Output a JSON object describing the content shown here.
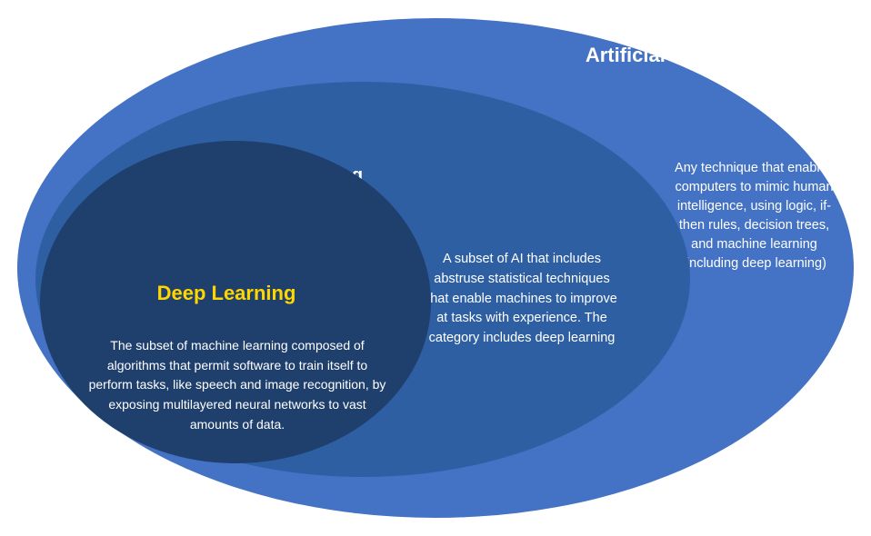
{
  "diagram": {
    "ai": {
      "title": "Artificial Intelligence",
      "description": "Any technique that enables computers to mimic human intelligence, using logic, if-then rules, decision trees, and machine learning (including deep learning)"
    },
    "ml": {
      "title": "Machine Learning",
      "description": "A subset of AI that includes abstruse statistical techniques that enable machines to improve at tasks with experience. The category includes deep learning"
    },
    "dl": {
      "title": "Deep Learning",
      "description": "The subset of machine learning composed of algorithms that permit software to train itself to perform tasks, like speech and image recognition, by exposing multilayered neural networks to vast amounts of data."
    }
  }
}
